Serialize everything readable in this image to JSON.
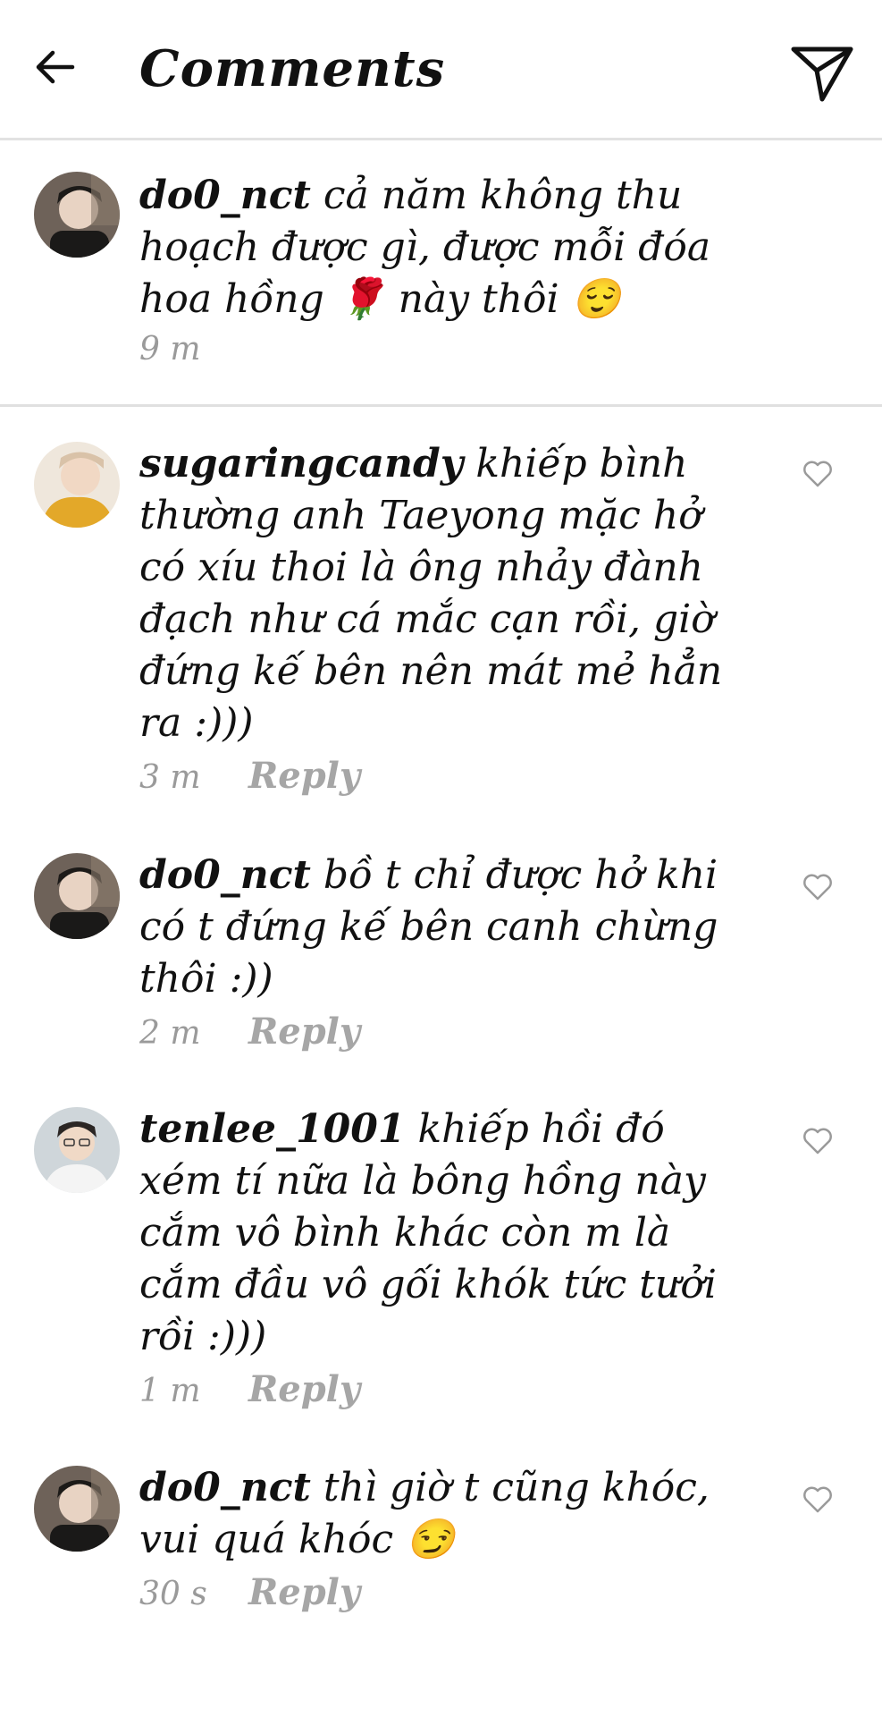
{
  "header": {
    "title": "Comments",
    "back_icon": "back-arrow-icon",
    "send_icon": "send-paper-plane-icon"
  },
  "caption": {
    "username": "do0_nct",
    "text": "cả năm không thu hoạch được gì, được mỗi đóa hoa hồng 🌹 này thôi 😌",
    "time": "9 m"
  },
  "comments": [
    {
      "username": "sugaringcandy",
      "text": "khiếp bình thường anh Taeyong mặc hở có xíu thoi là ông nhảy đành đạch như cá mắc cạn rồi, giờ đứng kế bên nên mát mẻ hẳn ra :)))",
      "time": "3 m",
      "reply": "Reply"
    },
    {
      "username": "do0_nct",
      "text": "bồ t chỉ được hở khi có t đứng kế bên canh chừng thôi :))",
      "time": "2 m",
      "reply": "Reply"
    },
    {
      "username": "tenlee_1001",
      "text": "khiếp hồi đó xém tí nữa là bông hồng này cắm vô bình khác còn m là cắm đầu vô gối khók tức tưởi rồi :)))",
      "time": "1 m",
      "reply": "Reply"
    },
    {
      "username": "do0_nct",
      "text": "thì giờ t cũng khóc, vui quá khóc 😏",
      "time": "30 s",
      "reply": "Reply"
    }
  ]
}
